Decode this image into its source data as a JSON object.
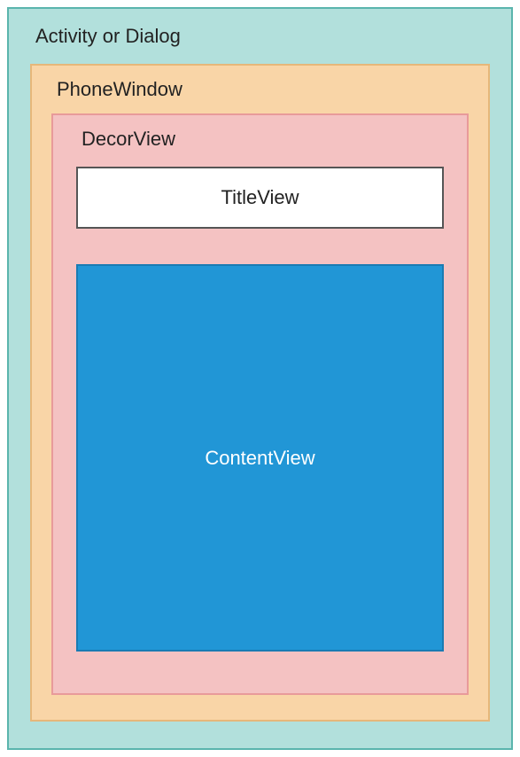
{
  "diagram": {
    "activity": {
      "label": "Activity or Dialog"
    },
    "phoneWindow": {
      "label": "PhoneWindow"
    },
    "decorView": {
      "label": "DecorView"
    },
    "titleView": {
      "label": "TitleView"
    },
    "contentView": {
      "label": "ContentView"
    }
  }
}
